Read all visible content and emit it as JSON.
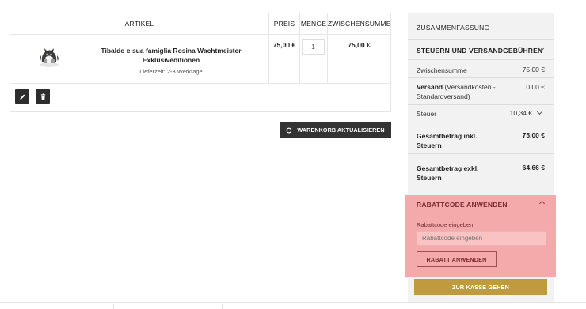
{
  "cart": {
    "headers": {
      "artikel": "ARTIKEL",
      "preis": "PREIS",
      "menge": "MENGE",
      "zwischensumme": "ZWISCHENSUMME"
    },
    "items": [
      {
        "name": "Tibaldo e sua famiglia Rosina Wachtmeister Exklusiveditionen",
        "delivery": "Lieferzeit: 2-3 Werktage",
        "price": "75,00 €",
        "quantity": "1",
        "subtotal": "75,00 €"
      }
    ],
    "icons": {
      "edit": "pencil-icon",
      "delete": "trash-icon"
    },
    "update_button": {
      "label": "WARENKORB AKTUALISIEREN",
      "icon": "refresh-icon"
    }
  },
  "summary": {
    "title": "ZUSAMMENFASSUNG",
    "shipping_section": "STEUERN UND VERSANDGEBÜHREN",
    "rows": {
      "subtotal_label": "Zwischensumme",
      "subtotal_value": "75,00 €",
      "shipping_label": "Versand",
      "shipping_detail": " (Versandkosten - Standardversand)",
      "shipping_value": "0,00 €",
      "tax_label": "Steuer",
      "tax_value": "10,34 €",
      "total_incl_label": "Gesamtbetrag inkl. Steuern",
      "total_incl_value": "75,00 €",
      "total_excl_label": "Gesamtbetrag exkl. Steuern",
      "total_excl_value": "64,66 €"
    },
    "checkout_button": "ZUR KASSE GEHEN"
  },
  "discount": {
    "title": "RABATTCODE ANWENDEN",
    "label": "Rabattcode eingeben",
    "placeholder": "Rabattcode eingeben",
    "button": "RABATT ANWENDEN"
  },
  "colors": {
    "highlight": "#f4a9ab",
    "checkout": "#bf9a3e",
    "dark_button": "#333333",
    "summary_bg": "#f2f2f2"
  }
}
